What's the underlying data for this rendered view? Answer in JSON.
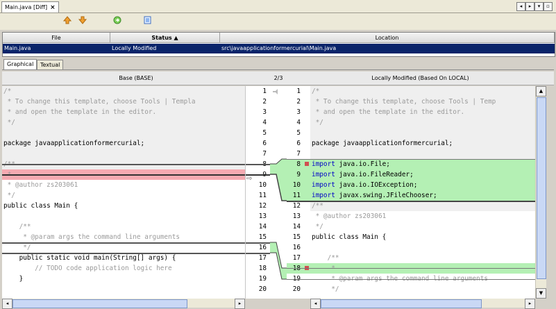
{
  "tab": {
    "title": "Main.java [Diff]",
    "close": "×"
  },
  "nav_buttons": [
    "◂",
    "▸",
    "▾",
    "▫"
  ],
  "toolbar_icons": [
    "arrow-up-orange-icon",
    "arrow-down-orange-icon",
    "refresh-green-icon",
    "export-blue-icon"
  ],
  "table": {
    "headers": [
      "File",
      "Status ▲",
      "Location"
    ],
    "row": {
      "file": "Main.java",
      "status": "Locally Modified",
      "location": "src\\javaapplicationformercurial\\Main.java"
    }
  },
  "view_tabs": [
    "Graphical",
    "Textual"
  ],
  "headers": {
    "left": "Base (BASE)",
    "middle": "2/3",
    "right": "Locally Modified (Based On LOCAL)"
  },
  "left_lines": [
    {
      "n": "1",
      "t": "/*",
      "c": "cmt"
    },
    {
      "n": "2",
      "t": " * To change this template, choose Tools | Templa",
      "c": "cmt"
    },
    {
      "n": "3",
      "t": " * and open the template in the editor.",
      "c": "cmt"
    },
    {
      "n": "4",
      "t": " */",
      "c": "cmt"
    },
    {
      "n": "5",
      "t": "",
      "c": ""
    },
    {
      "n": "6",
      "t": "package javaapplicationformercurial;",
      "c": ""
    },
    {
      "n": "7",
      "t": "",
      "c": ""
    },
    {
      "n": "8",
      "t": "/**",
      "c": "cmt"
    },
    {
      "n": "9",
      "t": " *",
      "c": "cmt"
    },
    {
      "n": "10",
      "t": " * @author zs203061",
      "c": "cmt"
    },
    {
      "n": "11",
      "t": " */",
      "c": "cmt"
    },
    {
      "n": "12",
      "t": "public class Main {",
      "c": ""
    },
    {
      "n": "13",
      "t": "",
      "c": ""
    },
    {
      "n": "14",
      "t": "    /**",
      "c": "cmt"
    },
    {
      "n": "15",
      "t": "     * @param args the command line arguments",
      "c": "cmt"
    },
    {
      "n": "16",
      "t": "     */",
      "c": "cmt"
    },
    {
      "n": "17",
      "t": "    public static void main(String[] args) {",
      "c": ""
    },
    {
      "n": "18",
      "t": "        // TODO code application logic here",
      "c": "cmt"
    },
    {
      "n": "19",
      "t": "    }",
      "c": ""
    },
    {
      "n": "20",
      "t": "",
      "c": ""
    }
  ],
  "right_lines": [
    {
      "n": "1",
      "t": "/*",
      "c": "cmt"
    },
    {
      "n": "2",
      "t": " * To change this template, choose Tools | Temp",
      "c": "cmt"
    },
    {
      "n": "3",
      "t": " * and open the template in the editor.",
      "c": "cmt"
    },
    {
      "n": "4",
      "t": " */",
      "c": "cmt"
    },
    {
      "n": "5",
      "t": "",
      "c": ""
    },
    {
      "n": "6",
      "t": "package javaapplicationformercurial;",
      "c": ""
    },
    {
      "n": "7",
      "t": "",
      "c": ""
    },
    {
      "n": "8",
      "t": "import java.io.File;",
      "c": "imp"
    },
    {
      "n": "9",
      "t": "import java.io.FileReader;",
      "c": "imp"
    },
    {
      "n": "10",
      "t": "import java.io.IOException;",
      "c": "imp"
    },
    {
      "n": "11",
      "t": "import javax.swing.JFileChooser;",
      "c": "imp"
    },
    {
      "n": "12",
      "t": "/**",
      "c": "cmt"
    },
    {
      "n": "13",
      "t": " * @author zs203061",
      "c": "cmt"
    },
    {
      "n": "14",
      "t": " */",
      "c": "cmt"
    },
    {
      "n": "15",
      "t": "public class Main {",
      "c": ""
    },
    {
      "n": "16",
      "t": "",
      "c": ""
    },
    {
      "n": "17",
      "t": "    /**",
      "c": "cmt"
    },
    {
      "n": "18",
      "t": "     *",
      "c": "cmt"
    },
    {
      "n": "19",
      "t": "     * @param args the command line arguments",
      "c": "cmt"
    },
    {
      "n": "20",
      "t": "     */",
      "c": "cmt"
    }
  ],
  "colors": {
    "added": "#b4f0b4",
    "removed": "#f5aab1",
    "selection": "#0a246a",
    "changed_marker": "#d05050"
  }
}
